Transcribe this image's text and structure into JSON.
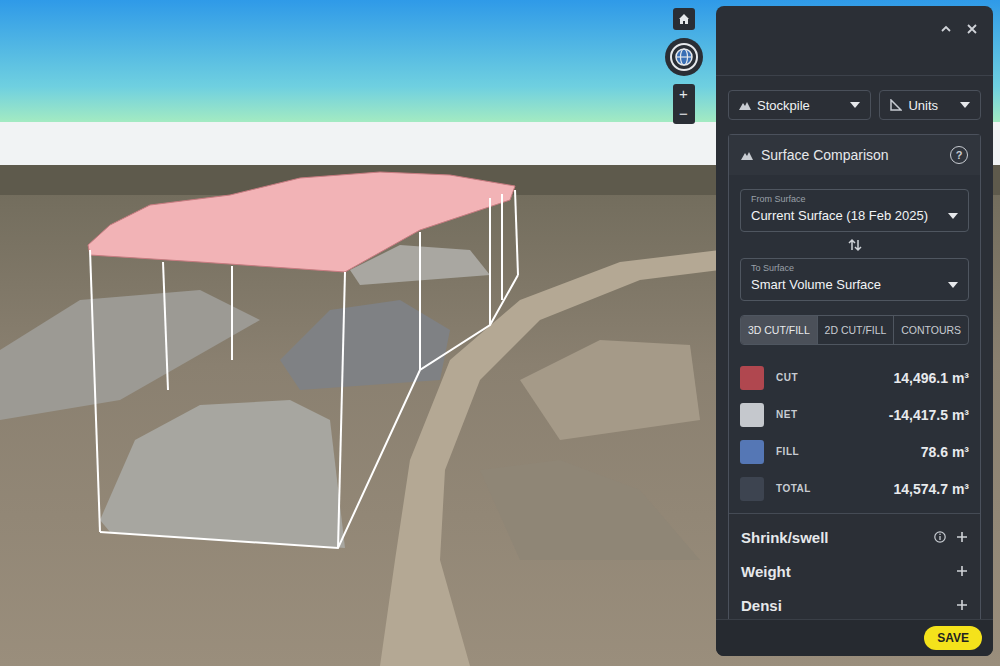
{
  "map_controls": {
    "zoom_in": "+",
    "zoom_out": "−"
  },
  "dropdowns": [
    {
      "label": "Stockpile",
      "kind": "stockpile"
    },
    {
      "label": "Units",
      "kind": "units"
    }
  ],
  "surface_comparison": {
    "title": "Surface Comparison",
    "help": "?",
    "from_surface": {
      "label": "From Surface",
      "value": "Current Surface (18 Feb 2025)"
    },
    "to_surface": {
      "label": "To Surface",
      "value": "Smart Volume Surface"
    },
    "tabs": [
      {
        "label": "3D CUT/FILL",
        "selected": true
      },
      {
        "label": "2D CUT/FILL",
        "selected": false
      },
      {
        "label": "CONTOURS",
        "selected": false
      }
    ],
    "results": [
      {
        "label": "CUT",
        "value": "14,496.1 m³",
        "color": "#b0474f"
      },
      {
        "label": "NET",
        "value": "-14,417.5 m³",
        "color": "#c5c8cd"
      },
      {
        "label": "FILL",
        "value": "78.6 m³",
        "color": "#5577b5"
      },
      {
        "label": "TOTAL",
        "value": "14,574.7 m³",
        "color": "#3d4450"
      }
    ],
    "sections": [
      {
        "label": "Shrink/swell",
        "kind": "info"
      },
      {
        "label": "Weight",
        "kind": "plain"
      },
      {
        "label": "Densi",
        "kind": "plain"
      }
    ]
  },
  "save_button": "SAVE"
}
